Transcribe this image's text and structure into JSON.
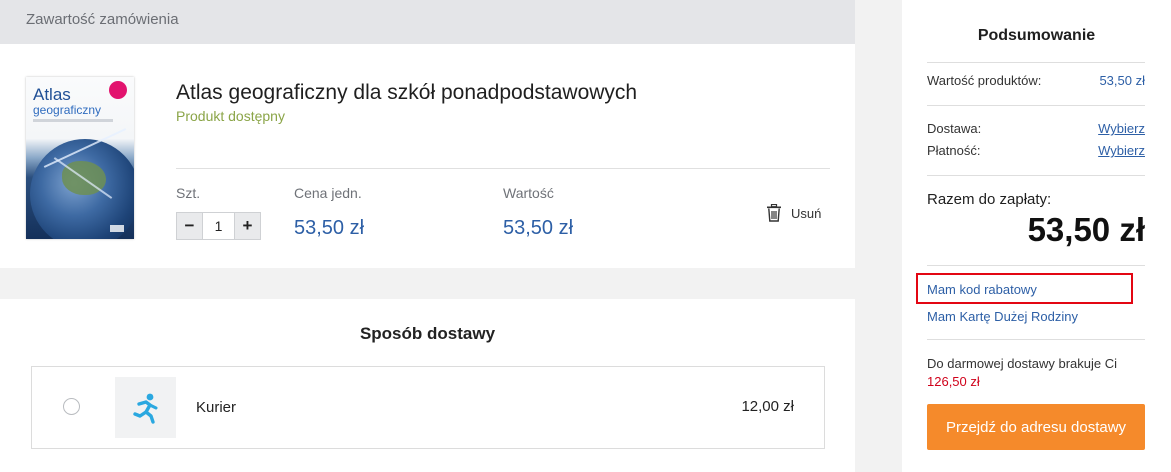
{
  "order": {
    "header": "Zawartość zamówienia",
    "product": {
      "cover": {
        "title": "Atlas",
        "subtitle": "geograficzny"
      },
      "name": "Atlas geograficzny dla szkół ponadpodstawowych",
      "availability": "Produkt dostępny",
      "qty_label": "Szt.",
      "qty_value": "1",
      "qty_minus": "−",
      "qty_plus": "+",
      "unit_price_label": "Cena jedn.",
      "unit_price": "53,50 zł",
      "value_label": "Wartość",
      "value": "53,50 zł",
      "remove_label": "Usuń"
    }
  },
  "delivery": {
    "title": "Sposób dostawy",
    "options": [
      {
        "name": "Kurier",
        "price": "12,00 zł",
        "icon": "running-person-icon"
      }
    ]
  },
  "summary": {
    "title": "Podsumowanie",
    "products_label": "Wartość produktów:",
    "products_value": "53,50 zł",
    "shipping_label": "Dostawa:",
    "shipping_link": "Wybierz",
    "payment_label": "Płatność:",
    "payment_link": "Wybierz",
    "total_label": "Razem do zapłaty:",
    "total_value": "53,50 zł",
    "discount_link": "Mam kod rabatowy",
    "family_card_link": "Mam Kartę Dużej Rodziny",
    "free_shipping_text": "Do darmowej dostawy brakuje Ci",
    "free_shipping_amount": "126,50 zł",
    "cta": "Przejdź do adresu dostawy"
  },
  "colors": {
    "accent_blue": "#2d5fa6",
    "available_green": "#8ba548",
    "cta_orange": "#f58a2b",
    "highlight_red": "#e30613",
    "missing_amount_red": "#d0021b"
  }
}
